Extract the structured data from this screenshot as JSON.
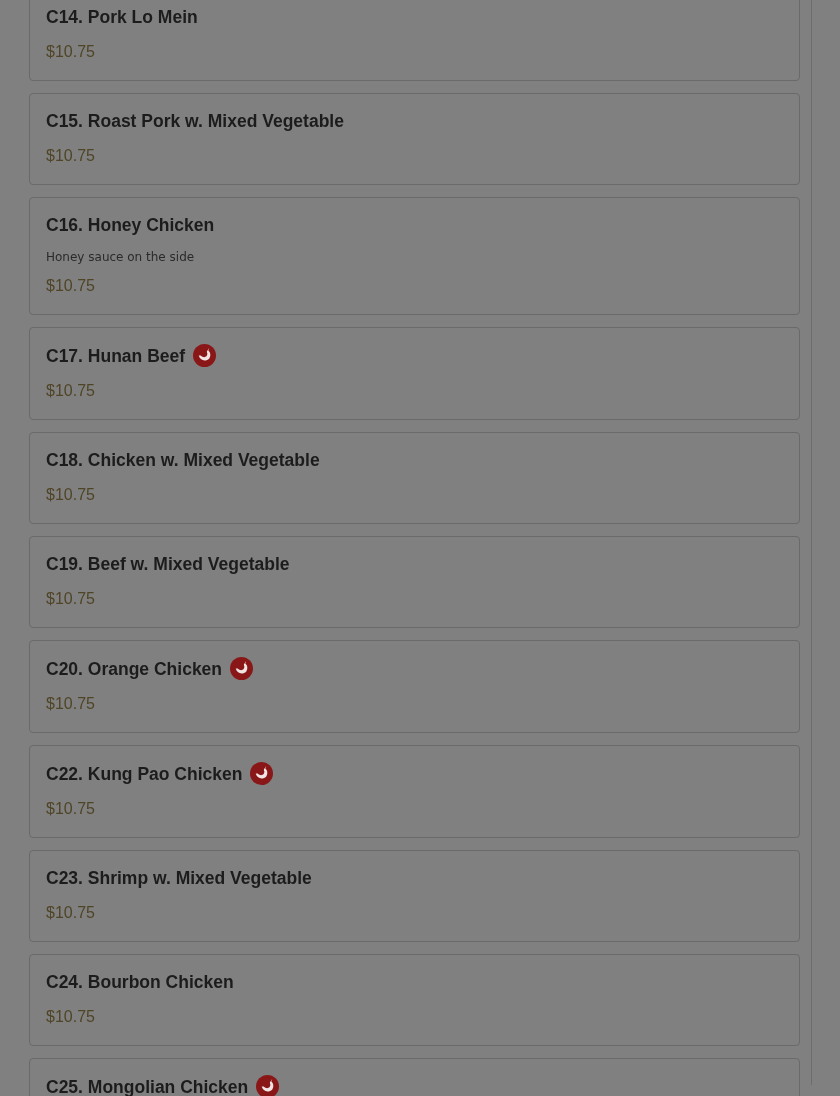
{
  "items": [
    {
      "name": "C14. Pork Lo Mein",
      "spicy": false,
      "price": "$10.75"
    },
    {
      "name": "C15. Roast Pork w. Mixed Vegetable",
      "spicy": false,
      "price": "$10.75"
    },
    {
      "name": "C16. Honey Chicken",
      "spicy": false,
      "description": "Honey sauce on the side",
      "price": "$10.75"
    },
    {
      "name": "C17. Hunan Beef",
      "spicy": true,
      "price": "$10.75"
    },
    {
      "name": "C18. Chicken w. Mixed Vegetable",
      "spicy": false,
      "price": "$10.75"
    },
    {
      "name": "C19. Beef w. Mixed Vegetable",
      "spicy": false,
      "price": "$10.75"
    },
    {
      "name": "C20. Orange Chicken",
      "spicy": true,
      "price": "$10.75"
    },
    {
      "name": "C22. Kung Pao Chicken",
      "spicy": true,
      "price": "$10.75"
    },
    {
      "name": "C23. Shrimp w. Mixed Vegetable",
      "spicy": false,
      "price": "$10.75"
    },
    {
      "name": "C24. Bourbon Chicken",
      "spicy": false,
      "price": "$10.75"
    },
    {
      "name": "C25. Mongolian Chicken",
      "spicy": true
    }
  ]
}
